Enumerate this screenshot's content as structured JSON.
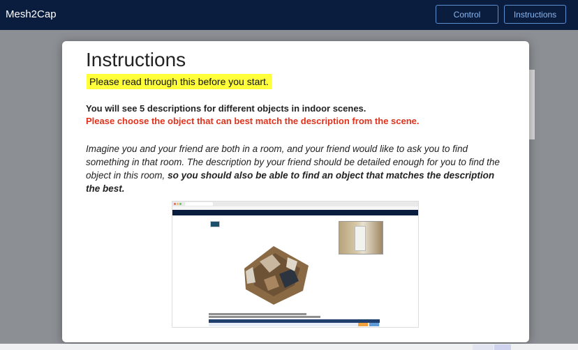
{
  "app": {
    "title": "Mesh2Cap"
  },
  "nav": {
    "control_label": "Control",
    "instructions_label": "Instructions"
  },
  "modal": {
    "title": "Instructions",
    "highlight": "Please read through this before you start.",
    "line1": "You will see 5 descriptions for different objects in indoor scenes.",
    "line2": "Please choose the object that can best match the description from the scene.",
    "para_part1": "Imagine you and your friend are both in a room, and your friend would like to ask you to find something in that room. The description by your friend should be detailed enough for you to find the object in this room, ",
    "para_bold": "so you should also be able to find an object that matches the description the best."
  },
  "colors": {
    "navbar": "#0b1d3f",
    "highlight": "#ffff3a",
    "warning_text": "#e0321c",
    "nav_button_border": "#5e8fcf"
  },
  "icons": {
    "example_screenshot": "example-task-screenshot"
  }
}
